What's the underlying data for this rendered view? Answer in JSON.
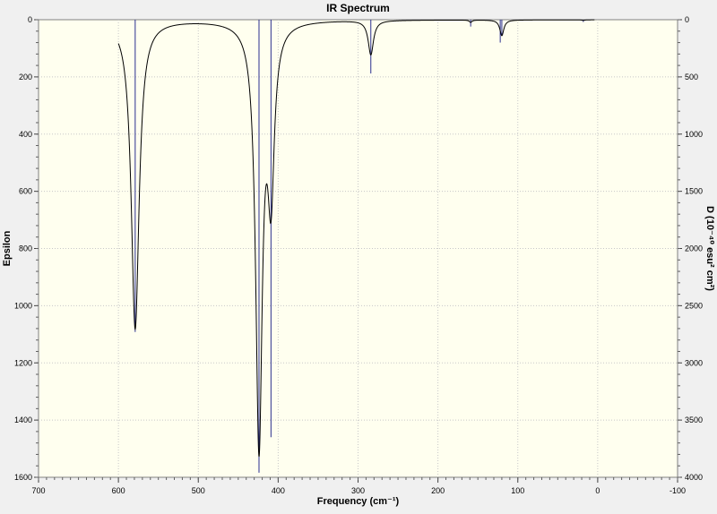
{
  "chart_data": {
    "type": "line",
    "title": "IR Spectrum",
    "xlabel": "Frequency (cm⁻¹)",
    "ylabel_left": "Epsilon",
    "ylabel_right": "D (10⁻⁴⁰ esu² cm²)",
    "xlim": [
      700,
      -100
    ],
    "ylim_left": [
      0,
      1600
    ],
    "ylim_right": [
      0,
      4000
    ],
    "x_ticks": [
      700,
      600,
      500,
      400,
      300,
      200,
      100,
      0,
      -100
    ],
    "y_left_ticks": [
      0,
      200,
      400,
      600,
      800,
      1000,
      1200,
      1400,
      1600
    ],
    "y_right_ticks": [
      0,
      500,
      1000,
      1500,
      2000,
      2500,
      3000,
      3500,
      4000
    ],
    "grid": true,
    "series": [
      {
        "kind": "spectrum",
        "color": "#000000",
        "x_range": [
          600,
          4
        ],
        "peaks": [
          {
            "x": 579,
            "epsilon": 1080,
            "width": 6
          },
          {
            "x": 424,
            "epsilon": 1470,
            "width": 5
          },
          {
            "x": 409,
            "epsilon": 560,
            "width": 5
          },
          {
            "x": 284,
            "epsilon": 120,
            "width": 4
          },
          {
            "x": 159,
            "epsilon": 8,
            "width": 2
          },
          {
            "x": 120,
            "epsilon": 55,
            "width": 3
          },
          {
            "x": 18,
            "epsilon": 2,
            "width": 2
          }
        ]
      },
      {
        "kind": "sticks",
        "color": "#2b2f8f",
        "sticks": [
          {
            "x": 579,
            "d": 2730
          },
          {
            "x": 424,
            "d": 3960
          },
          {
            "x": 409,
            "d": 3650
          },
          {
            "x": 284,
            "d": 470
          },
          {
            "x": 159,
            "d": 60
          },
          {
            "x": 120,
            "d": 140
          },
          {
            "x": 122,
            "d": 200
          },
          {
            "x": 18,
            "d": 20
          }
        ]
      }
    ]
  }
}
